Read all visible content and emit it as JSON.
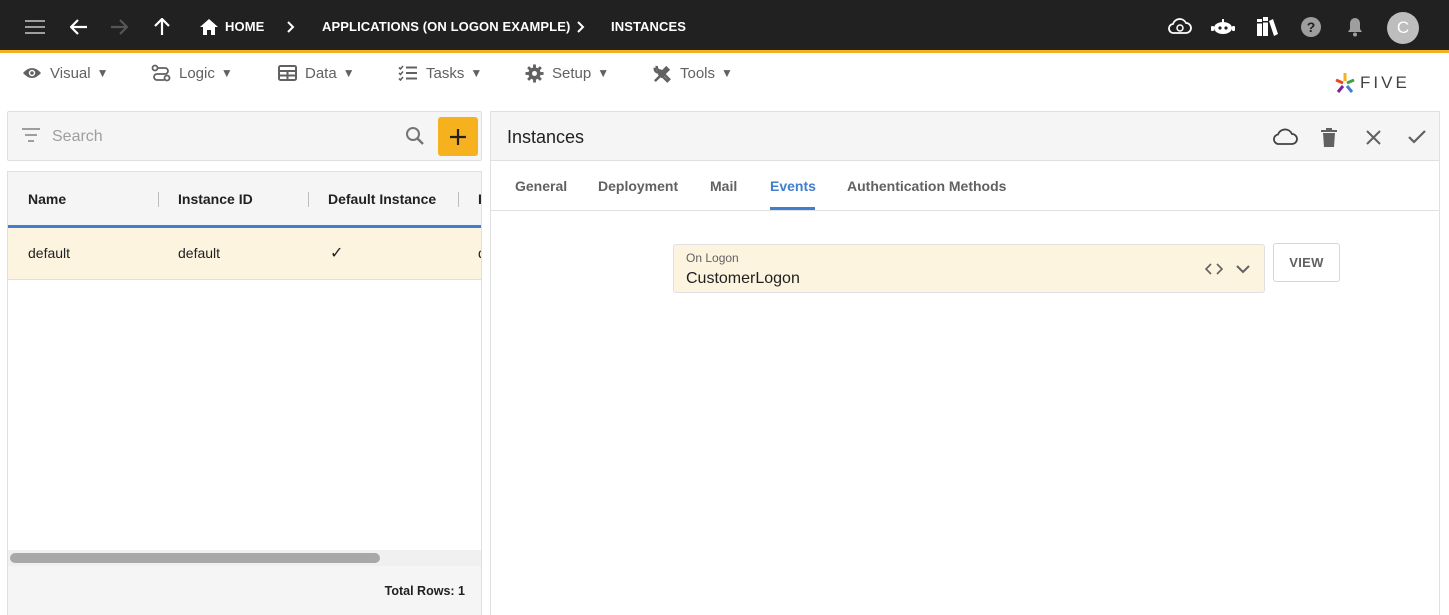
{
  "topbar": {
    "breadcrumbs": [
      "HOME",
      "APPLICATIONS (ON LOGON EXAMPLE)",
      "INSTANCES"
    ],
    "avatar_letter": "C",
    "accent_color": "#f6b11f"
  },
  "menu": {
    "items": [
      {
        "label": "Visual",
        "icon": "eye-icon"
      },
      {
        "label": "Logic",
        "icon": "logic-icon"
      },
      {
        "label": "Data",
        "icon": "table-icon"
      },
      {
        "label": "Tasks",
        "icon": "checklist-icon"
      },
      {
        "label": "Setup",
        "icon": "gear-icon"
      },
      {
        "label": "Tools",
        "icon": "tools-icon"
      }
    ],
    "caret": "▼",
    "logo_text": "FIVE"
  },
  "list": {
    "search_placeholder": "Search",
    "columns": [
      "Name",
      "Instance ID",
      "Default Instance",
      "I"
    ],
    "rows": [
      {
        "name": "default",
        "instance_id": "default",
        "default_instance": "✓",
        "extra": "d"
      }
    ],
    "total_rows": "Total Rows: 1"
  },
  "form": {
    "title": "Instances",
    "tabs": [
      "General",
      "Deployment",
      "Mail",
      "Events",
      "Authentication Methods"
    ],
    "active_tab": "Events",
    "field": {
      "label": "On Logon",
      "value": "CustomerLogon"
    },
    "view_button": "VIEW"
  },
  "colors": {
    "active_tab": "#3f7fce",
    "selected_row": "#fdf4e0",
    "add_button": "#f6b11f"
  }
}
